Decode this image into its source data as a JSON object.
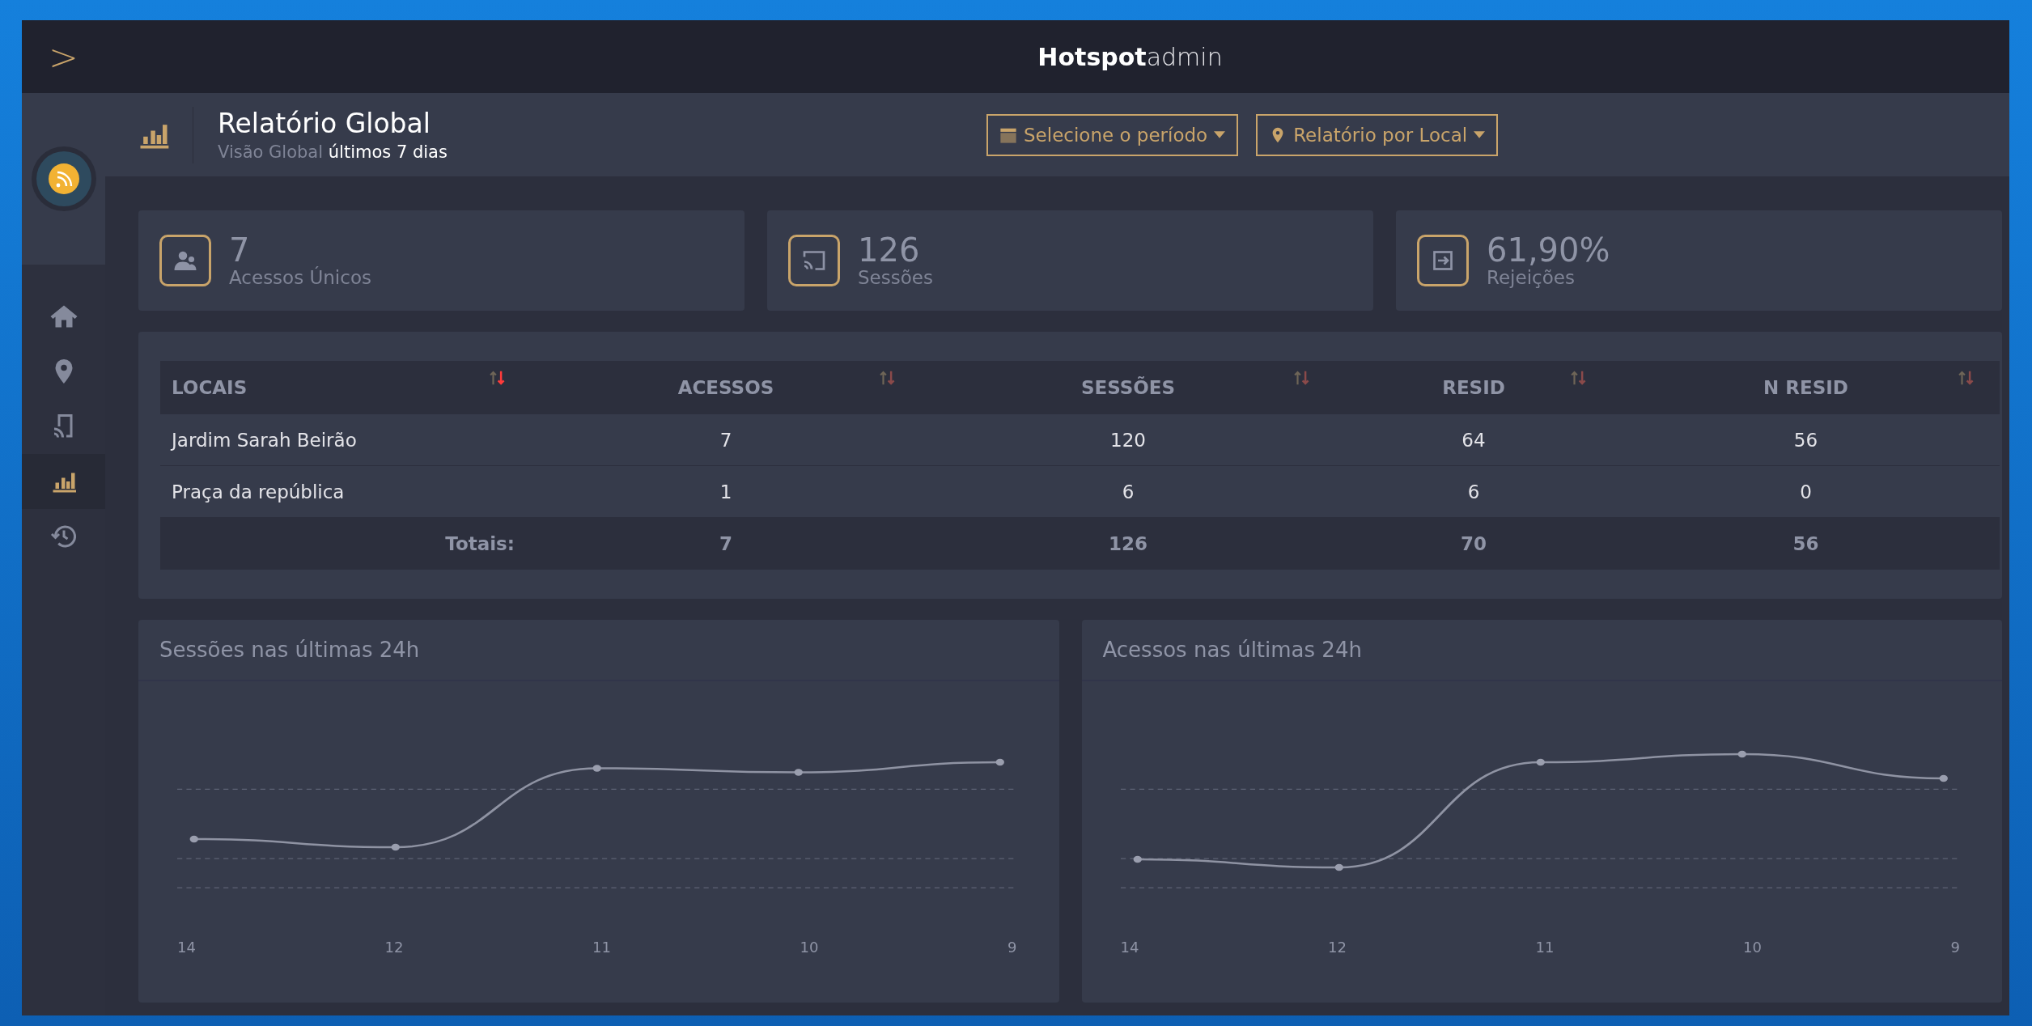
{
  "sidebar": {
    "toggle": ">",
    "items": [
      {
        "kind": "home",
        "selected": false
      },
      {
        "kind": "pin",
        "selected": false
      },
      {
        "kind": "cast",
        "selected": false
      },
      {
        "kind": "chart",
        "selected": true
      },
      {
        "kind": "history",
        "selected": false
      }
    ]
  },
  "header": {
    "logo": "**Hotspot**admin"
  },
  "page": {
    "title": "Relatório Global",
    "subtitle": "Visão Global",
    "period": "últimos 7 dias",
    "filters": [
      {
        "kind": "calendar",
        "label": "Selecione o período"
      },
      {
        "kind": "pin",
        "label": "Relatório por Local"
      }
    ]
  },
  "stats": [
    {
      "kind": "users",
      "value": "7",
      "label": "Acessos Únicos"
    },
    {
      "kind": "cast",
      "value": "126",
      "label": "Sessões"
    },
    {
      "kind": "exit",
      "value": "61,90%",
      "label": "Rejeições"
    }
  ],
  "table": {
    "columns": [
      {
        "label": "LOCAIS",
        "sorted": true
      },
      {
        "label": "ACESSOS",
        "sorted": false
      },
      {
        "label": "SESSÕES",
        "sorted": false
      },
      {
        "label": "RESID",
        "sorted": false
      },
      {
        "label": "N RESID",
        "sorted": false
      }
    ],
    "rows": [
      [
        "Jardim Sarah Beirão",
        "7",
        "120",
        "64",
        "56"
      ],
      [
        "Praça da república",
        "1",
        "6",
        "6",
        "0"
      ]
    ],
    "totals": {
      "label": "Totais:",
      "values": [
        "7",
        "126",
        "70",
        "56"
      ]
    }
  },
  "charts": [
    {
      "title": "Sessões nas últimas 24h",
      "x_labels": [
        "14",
        "12",
        "11",
        "10",
        "9"
      ]
    },
    {
      "title": "Acessos nas últimas 24h",
      "x_labels": [
        "14",
        "12",
        "11",
        "10",
        "9"
      ]
    }
  ]
}
